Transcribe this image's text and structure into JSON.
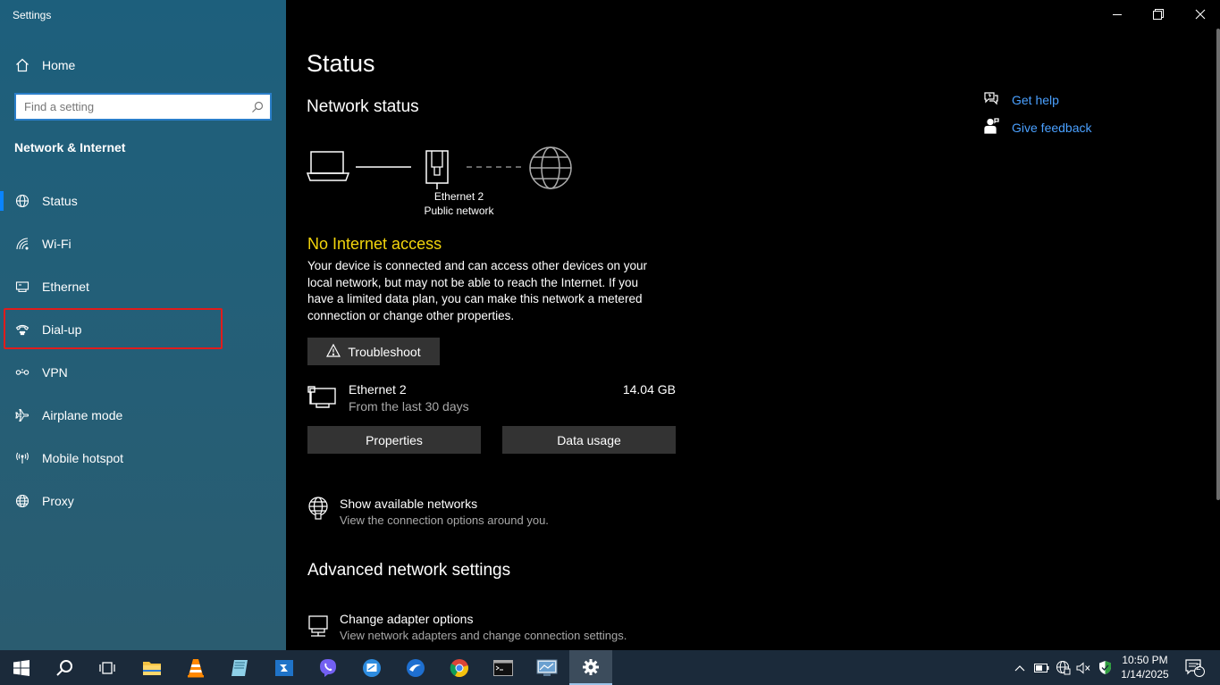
{
  "window": {
    "title": "Settings"
  },
  "sidebar": {
    "home_label": "Home",
    "search_placeholder": "Find a setting",
    "section_title": "Network & Internet",
    "items": [
      {
        "label": "Status",
        "icon": "globe-network-icon",
        "active": true
      },
      {
        "label": "Wi-Fi",
        "icon": "wifi-icon",
        "active": false
      },
      {
        "label": "Ethernet",
        "icon": "ethernet-icon",
        "active": false
      },
      {
        "label": "Dial-up",
        "icon": "dialup-icon",
        "active": false
      },
      {
        "label": "VPN",
        "icon": "vpn-icon",
        "active": false
      },
      {
        "label": "Airplane mode",
        "icon": "airplane-icon",
        "active": false
      },
      {
        "label": "Mobile hotspot",
        "icon": "hotspot-icon",
        "active": false
      },
      {
        "label": "Proxy",
        "icon": "globe-icon",
        "active": false
      }
    ]
  },
  "main": {
    "page_title": "Status",
    "network_status_title": "Network status",
    "diagram": {
      "adapter_name": "Ethernet 2",
      "network_type": "Public network"
    },
    "alert_title": "No Internet access",
    "alert_description": "Your device is connected and can access other devices on your local network, but may not be able to reach the Internet. If you have a limited data plan, you can make this network a metered connection or change other properties.",
    "troubleshoot_label": "Troubleshoot",
    "connection": {
      "name": "Ethernet 2",
      "period": "From the last 30 days",
      "usage": "14.04 GB"
    },
    "properties_label": "Properties",
    "data_usage_label": "Data usage",
    "show_networks": {
      "title": "Show available networks",
      "subtitle": "View the connection options around you."
    },
    "advanced_title": "Advanced network settings",
    "adapter_options": {
      "title": "Change adapter options",
      "subtitle": "View network adapters and change connection settings."
    }
  },
  "help": {
    "get_help": "Get help",
    "give_feedback": "Give feedback"
  },
  "taskbar": {
    "time": "10:50 PM",
    "date": "1/14/2025",
    "notification_count": "2"
  },
  "colors": {
    "sidebar_top": "#1d5f7c",
    "accent": "#0a84ff",
    "alert": "#f2d40c",
    "link": "#4aa0ff",
    "highlight_box": "#e01c1c"
  }
}
